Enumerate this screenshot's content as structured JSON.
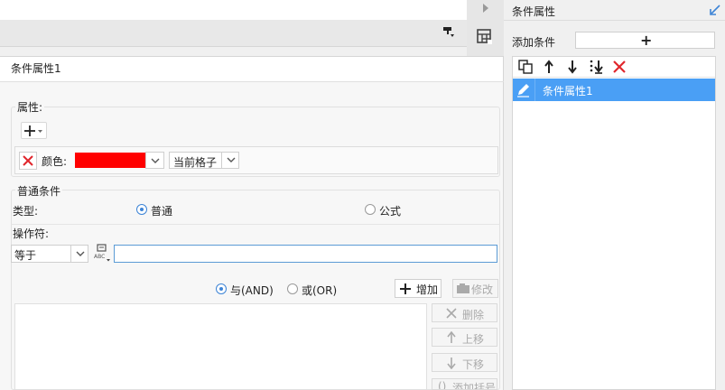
{
  "toolbar": {
    "format_brush_icon": "format-brush-icon"
  },
  "mid_column": {
    "collapse_icon": "triangle-right-icon",
    "table_icon": "table-grid-icon"
  },
  "panel": {
    "title": "条件属性1",
    "attributes": {
      "label": "属性:",
      "add_icon": "plus-dropdown-icon",
      "color_label": "颜色:",
      "color_value": "#ff0000",
      "scope_value": "当前格子"
    },
    "condition": {
      "label": "普通条件",
      "type_label": "类型:",
      "type_normal": "普通",
      "type_formula": "公式",
      "operator_label": "操作符:",
      "operator_value": "等于",
      "value_input": "",
      "and_label": "与(AND)",
      "or_label": "或(OR)",
      "add_label": "增加",
      "edit_label": "修改",
      "delete_label": "删除",
      "move_up_label": "上移",
      "move_down_label": "下移",
      "add_bracket_label": "添加括号"
    }
  },
  "right_panel": {
    "title": "条件属性",
    "add_condition_label": "添加条件",
    "add_button_symbol": "+",
    "items": [
      {
        "label": "条件属性1",
        "selected": true
      }
    ]
  },
  "colors": {
    "accent": "#4a9ff5",
    "danger": "#e0262c",
    "input_border": "#5b9bd5"
  }
}
